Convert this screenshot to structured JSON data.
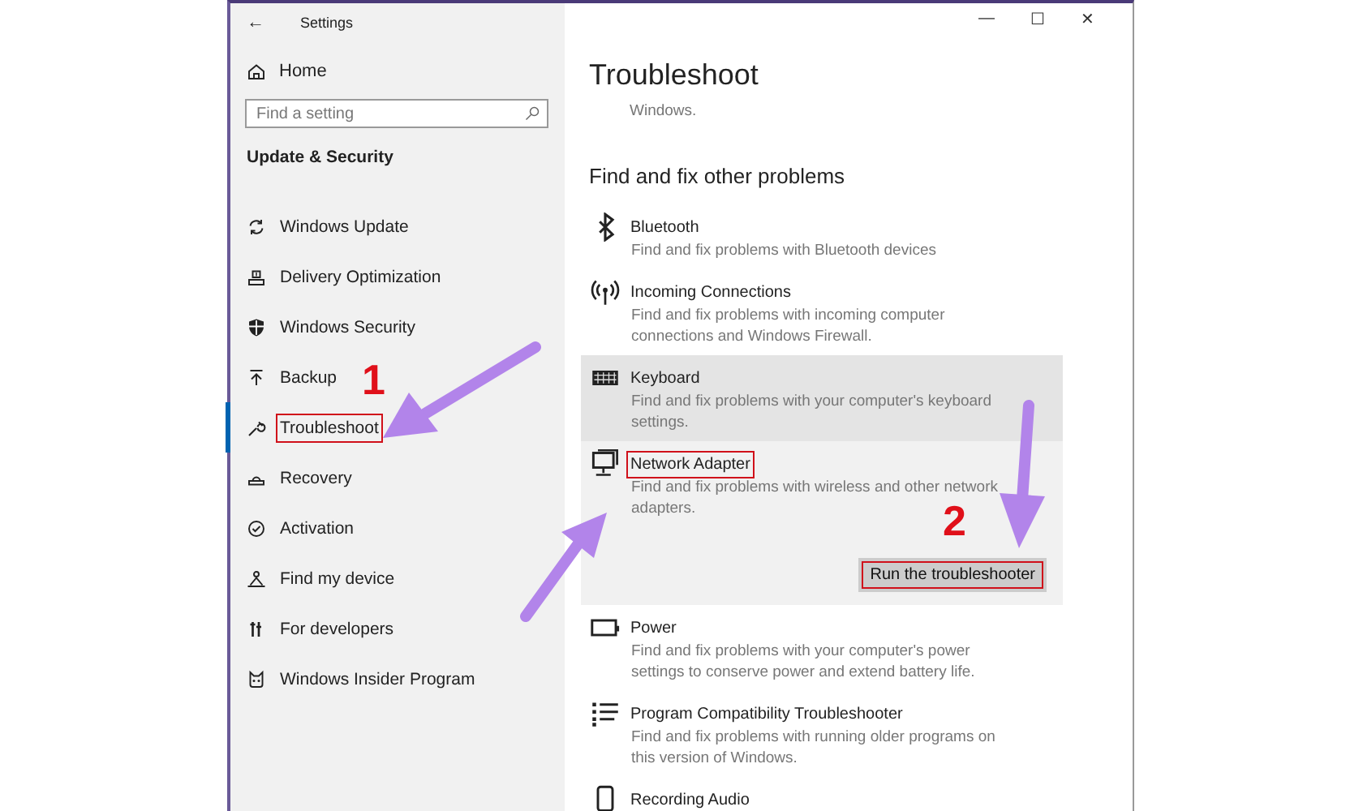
{
  "window": {
    "title": "Settings",
    "back": "←",
    "controls": [
      "—",
      "☐",
      "✕"
    ]
  },
  "sidebar": {
    "home": "Home",
    "search": {
      "placeholder": "Find a setting"
    },
    "section": "Update & Security",
    "items": [
      {
        "label": "Windows Update",
        "selected": false,
        "annotated": false
      },
      {
        "label": "Delivery Optimization",
        "selected": false,
        "annotated": false
      },
      {
        "label": "Windows Security",
        "selected": false,
        "annotated": false
      },
      {
        "label": "Backup",
        "selected": false,
        "annotated": false
      },
      {
        "label": "Troubleshoot",
        "selected": true,
        "annotated": true
      },
      {
        "label": "Recovery",
        "selected": false,
        "annotated": false
      },
      {
        "label": "Activation",
        "selected": false,
        "annotated": false
      },
      {
        "label": "Find my device",
        "selected": false,
        "annotated": false
      },
      {
        "label": "For developers",
        "selected": false,
        "annotated": false
      },
      {
        "label": "Windows Insider Program",
        "selected": false,
        "annotated": false
      }
    ]
  },
  "main": {
    "title": "Troubleshoot",
    "intro": "Windows.",
    "heading": "Find and fix other problems",
    "items": [
      {
        "title": "Bluetooth",
        "description": "Find and fix problems with Bluetooth devices",
        "highlighted": false,
        "expanded": false,
        "annotated": false
      },
      {
        "title": "Incoming Connections",
        "description": "Find and fix problems with incoming computer connections and Windows Firewall.",
        "highlighted": false,
        "expanded": false,
        "annotated": false
      },
      {
        "title": "Keyboard",
        "description": "Find and fix problems with your computer's keyboard settings.",
        "highlighted": true,
        "expanded": false,
        "annotated": false
      },
      {
        "title": "Network Adapter",
        "description": "Find and fix problems with wireless and other network adapters.",
        "highlighted": false,
        "expanded": true,
        "annotated": true,
        "button": {
          "label": "Run the troubleshooter",
          "annotated": true
        }
      },
      {
        "title": "Power",
        "description": "Find and fix problems with your computer's power settings to conserve power and extend battery life.",
        "highlighted": false,
        "expanded": false,
        "annotated": false
      },
      {
        "title": "Program Compatibility Troubleshooter",
        "description": "Find and fix problems with running older programs on this version of Windows.",
        "highlighted": false,
        "expanded": false,
        "annotated": false
      },
      {
        "title": "Recording Audio",
        "highlighted": false,
        "expanded": false,
        "annotated": false
      }
    ]
  },
  "annotations": [
    "1",
    "2"
  ]
}
